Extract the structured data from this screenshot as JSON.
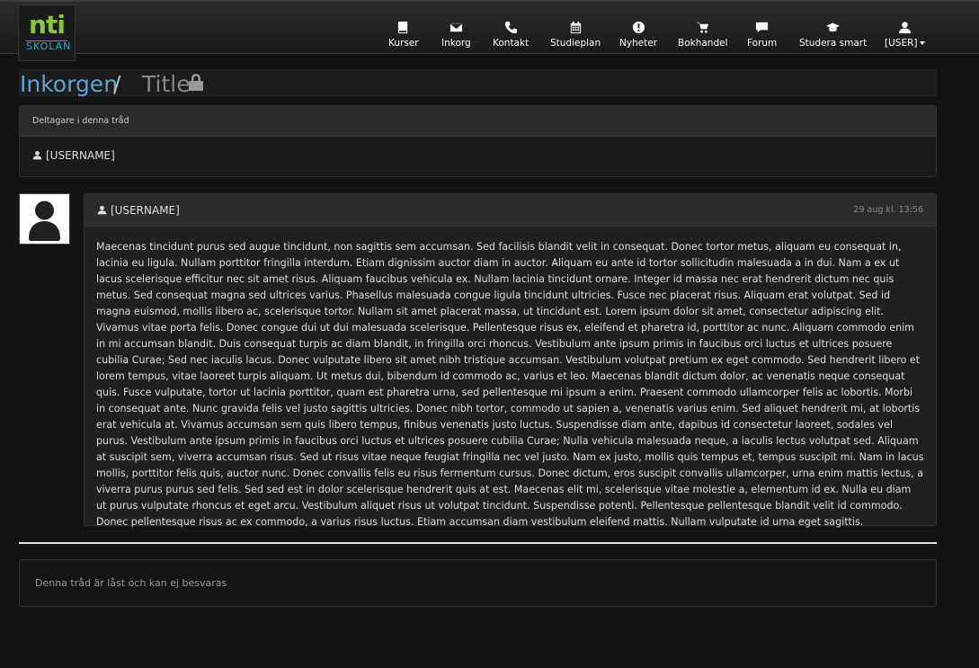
{
  "logo": {
    "top": "nti",
    "bottom": "SKOLAN"
  },
  "nav": {
    "items": [
      {
        "label": "Kurser",
        "icon": "book-icon"
      },
      {
        "label": "Inkorg",
        "icon": "envelope-icon"
      },
      {
        "label": "Kontakt",
        "icon": "phone-icon"
      },
      {
        "label": "Studieplan",
        "icon": "calendar-icon"
      },
      {
        "label": "Nyheter",
        "icon": "info-icon"
      },
      {
        "label": "Bokhandel",
        "icon": "cart-icon"
      },
      {
        "label": "Forum",
        "icon": "chat-icon"
      },
      {
        "label": "Studera smart",
        "icon": "graduation-cap-icon"
      },
      {
        "label": "[USER]",
        "icon": "user-icon"
      }
    ]
  },
  "breadcrumb": {
    "inbox": "Inkorgen",
    "separator": "/",
    "title": "Title"
  },
  "participants": {
    "heading": "Deltagare i denna tråd",
    "user": "[USERNAME]"
  },
  "message": {
    "author": "[USERNAME]",
    "date": "29 aug kl. 13:56",
    "body": "Maecenas tincidunt purus sed augue tincidunt, non sagittis sem accumsan. Sed facilisis blandit velit in consequat. Donec tortor metus, aliquam eu consequat in, lacinia eu ligula. Nullam porttitor fringilla interdum. Etiam dignissim auctor diam in auctor. Aliquam eu ante id tortor sollicitudin malesuada a in dui. Nam a ex ut lacus scelerisque efficitur nec sit amet risus. Aliquam faucibus vehicula ex. Nullam lacinia tincidunt ornare. Integer id massa nec erat hendrerit dictum nec quis metus. Sed consequat magna sed ultrices varius. Phasellus malesuada congue ligula tincidunt ultricies. Fusce nec placerat risus. Aliquam erat volutpat. Sed id magna euismod, mollis libero ac, scelerisque tortor. Nullam sit amet placerat massa, ut tincidunt est. Lorem ipsum dolor sit amet, consectetur adipiscing elit. Vivamus vitae porta felis. Donec congue dui ut dui malesuada scelerisque. Pellentesque risus ex, eleifend et pharetra id, porttitor ac nunc. Aliquam commodo enim in mi accumsan blandit. Duis consequat turpis ac diam blandit, in fringilla orci rhoncus. Vestibulum ante ipsum primis in faucibus orci luctus et ultrices posuere cubilia Curae; Sed nec iaculis lacus. Donec vulputate libero sit amet nibh tristique accumsan. Vestibulum volutpat pretium ex eget commodo. Sed hendrerit libero et lorem tempus, vitae laoreet turpis aliquam. Ut metus dui, bibendum id commodo ac, varius et leo. Maecenas blandit dictum dolor, ac venenatis neque consequat quis. Fusce vulputate, tortor ut lacinia porttitor, quam est pharetra urna, sed pellentesque mi ipsum a enim. Praesent commodo ullamcorper felis ac lobortis. Morbi in consequat ante. Nunc gravida felis vel justo sagittis ultricies. Donec nibh tortor, commodo ut sapien a, venenatis varius enim. Sed aliquet hendrerit mi, at lobortis erat vehicula at. Vivamus accumsan sem quis libero tempus, finibus venenatis justo luctus. Suspendisse diam ante, dapibus id consectetur laoreet, sodales vel purus. Vestibulum ante ipsum primis in faucibus orci luctus et ultrices posuere cubilia Curae; Nulla vehicula malesuada neque, a iaculis lectus volutpat sed. Aliquam at suscipit sem, viverra accumsan risus. Sed ut risus vitae neque feugiat fringilla nec vel justo. Nam ex justo, mollis quis tempus et, tempus suscipit mi. Nam in lacus mollis, porttitor felis quis, auctor nunc. Donec convallis felis eu risus fermentum cursus. Donec dictum, eros suscipit convallis ullamcorper, urna enim mattis lectus, a viverra purus purus sed felis. Sed sed est in dolor scelerisque hendrerit quis at est. Maecenas elit mi, scelerisque vitae molestie a, elementum id ex. Nulla eu diam ut purus vulputate rhoncus et eget arcu. Vestibulum aliquet risus ut volutpat tincidunt. Suspendisse potenti. Pellentesque pellentesque blandit velit id commodo. Donec pellentesque risus ac ex commodo, a varius risus luctus. Etiam accumsan diam vestibulum eleifend mattis. Nullam vulputate id urna eget sagittis."
  },
  "locked_notice": "Denna tråd är låst och kan ej besvaras",
  "colors": {
    "accent_link": "#5fa3d6",
    "logo_green": "#8cc63f",
    "logo_blue": "#2aa7c9",
    "background": "#131313"
  }
}
